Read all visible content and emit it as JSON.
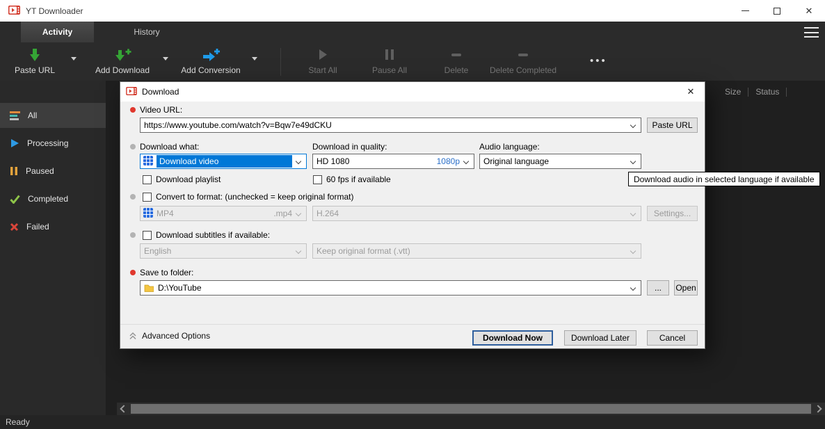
{
  "window": {
    "title": "YT Downloader"
  },
  "tabs": {
    "activity": "Activity",
    "history": "History"
  },
  "toolbar": {
    "paste_url": "Paste URL",
    "add_download": "Add Download",
    "add_conversion": "Add Conversion",
    "start_all": "Start All",
    "pause_all": "Pause All",
    "delete": "Delete",
    "delete_completed": "Delete Completed",
    "more": "•••"
  },
  "sidebar": {
    "items": [
      {
        "label": "All"
      },
      {
        "label": "Processing"
      },
      {
        "label": "Paused"
      },
      {
        "label": "Completed"
      },
      {
        "label": "Failed"
      }
    ]
  },
  "list": {
    "headers": {
      "size": "Size",
      "status": "Status"
    }
  },
  "dialog": {
    "title": "Download",
    "video_url": {
      "label": "Video URL:",
      "value": "https://www.youtube.com/watch?v=Bqw7e49dCKU",
      "paste_button": "Paste URL"
    },
    "download_what": {
      "label": "Download what:",
      "value": "Download video"
    },
    "quality": {
      "label": "Download in quality:",
      "value": "HD 1080",
      "right": "1080p"
    },
    "audio_language": {
      "label": "Audio language:",
      "value": "Original language"
    },
    "checkboxes": {
      "download_playlist": "Download playlist",
      "fps60": "60 fps if available",
      "convert": "Convert to format: (unchecked = keep original format)",
      "subtitles": "Download subtitles if available:"
    },
    "convert": {
      "format": "MP4",
      "format_ext": ".mp4",
      "codec": "H.264",
      "settings_button": "Settings..."
    },
    "subtitles": {
      "language": "English",
      "format": "Keep original format (.vtt)"
    },
    "save_folder": {
      "label": "Save to folder:",
      "value": "D:\\YouTube",
      "browse_button": "...",
      "open_button": "Open"
    },
    "footer": {
      "advanced": "Advanced Options",
      "download_now": "Download Now",
      "download_later": "Download Later",
      "cancel": "Cancel"
    }
  },
  "tooltip": {
    "text": "Download audio in selected language if available"
  },
  "statusbar": {
    "text": "Ready"
  },
  "icons": {
    "close_glyph": "✕"
  },
  "colors": {
    "accent": "#0078d7",
    "required": "#e0382e",
    "brand_red": "#d33a2c"
  }
}
